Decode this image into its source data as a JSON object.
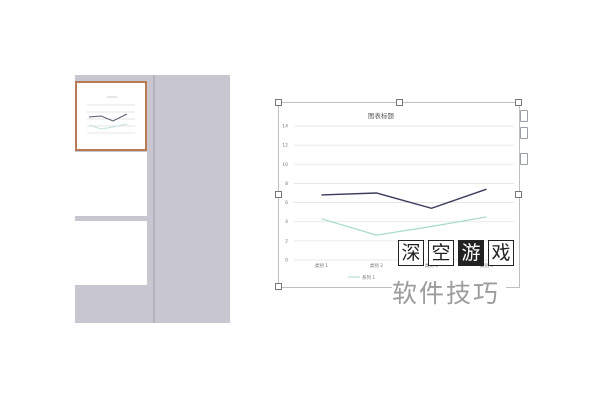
{
  "chart_data": {
    "type": "line",
    "title": "图表标题",
    "categories": [
      "类别 1",
      "类别 2",
      "类别 3",
      "类别 4"
    ],
    "yticks": [
      "0",
      "2",
      "4",
      "6",
      "8",
      "10",
      "12",
      "14"
    ],
    "ylim": [
      0,
      14
    ],
    "series": [
      {
        "values": [
          6.8,
          7.0,
          5.4,
          7.4
        ],
        "color": "#3b3d5c"
      },
      {
        "values": [
          4.3,
          2.6,
          3.5,
          4.5
        ],
        "color": "#a8d8cf"
      }
    ],
    "legend_text": "系列 1",
    "legend_position": "bottom",
    "grid": true
  },
  "watermark": {
    "chars": [
      "深",
      "空",
      "游",
      "戏"
    ],
    "text": "软件技巧"
  },
  "colors": {
    "frame_bg": "#c8c7d1",
    "selected_thumb_border": "#b97a56"
  }
}
